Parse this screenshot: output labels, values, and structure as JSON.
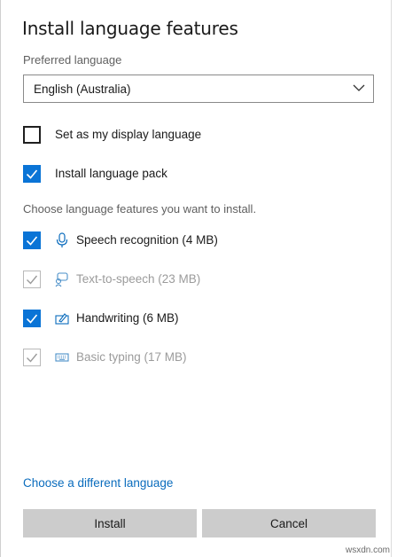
{
  "dialog": {
    "title": "Install language features",
    "preferred_language_label": "Preferred language",
    "selected_language": "English (Australia)",
    "display_language_label": "Set as my display language",
    "display_language_checked": false,
    "language_pack_label": "Install language pack",
    "language_pack_checked": true,
    "features_hint": "Choose language features you want to install."
  },
  "features": [
    {
      "label": "Speech recognition (4 MB)",
      "icon": "microphone-icon",
      "checked": true,
      "enabled": true
    },
    {
      "label": "Text-to-speech (23 MB)",
      "icon": "speech-bubble-icon",
      "checked": true,
      "enabled": false
    },
    {
      "label": "Handwriting (6 MB)",
      "icon": "handwriting-icon",
      "checked": true,
      "enabled": true
    },
    {
      "label": "Basic typing (17 MB)",
      "icon": "keyboard-icon",
      "checked": true,
      "enabled": false
    }
  ],
  "footer": {
    "change_language_link": "Choose a different language",
    "install_label": "Install",
    "cancel_label": "Cancel"
  },
  "watermark": "wsxdn.com",
  "colors": {
    "accent": "#0a74d6",
    "link": "#0a6cbd",
    "button_bg": "#cccccc",
    "disabled_text": "#9b9b9b"
  }
}
